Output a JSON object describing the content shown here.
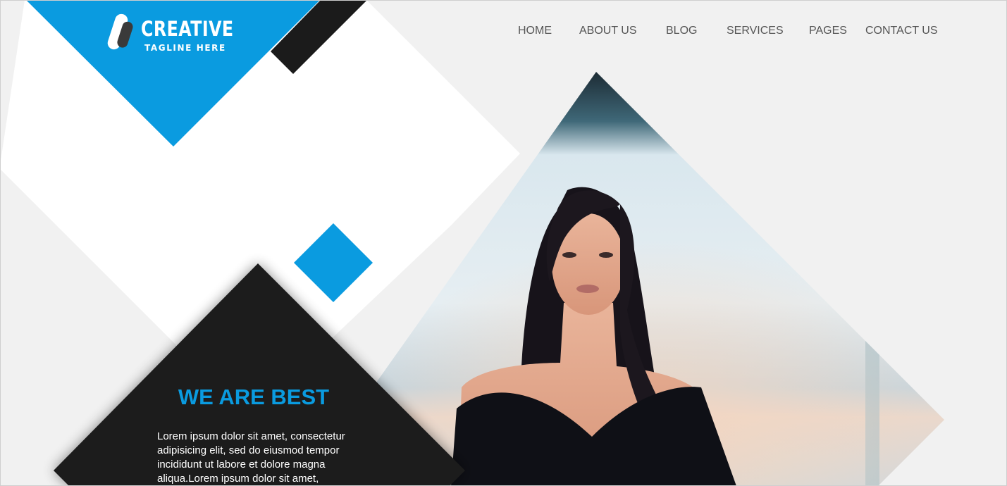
{
  "brand": {
    "name": "CREATIVE",
    "tagline": "TAGLINE HERE",
    "logo_icon": "capsule-logo-icon"
  },
  "nav": {
    "items": [
      {
        "label": "HOME"
      },
      {
        "label": "ABOUT US"
      },
      {
        "label": "BLOG"
      },
      {
        "label": "SERVICES"
      },
      {
        "label": "PAGES"
      },
      {
        "label": "CONTACT US"
      }
    ]
  },
  "hero": {
    "title": "WE ARE BEST",
    "body": "Lorem ipsum dolor sit amet, consectetur adipisicing elit, sed do eiusmod tempor incididunt ut labore et dolore magna aliqua.Lorem ipsum dolor sit amet,",
    "photo": "woman-portrait-photo"
  },
  "colors": {
    "accent": "#0a9be0",
    "dark": "#1b1b1b",
    "light_gray": "#f1f1f1",
    "nav_text": "#555555"
  }
}
